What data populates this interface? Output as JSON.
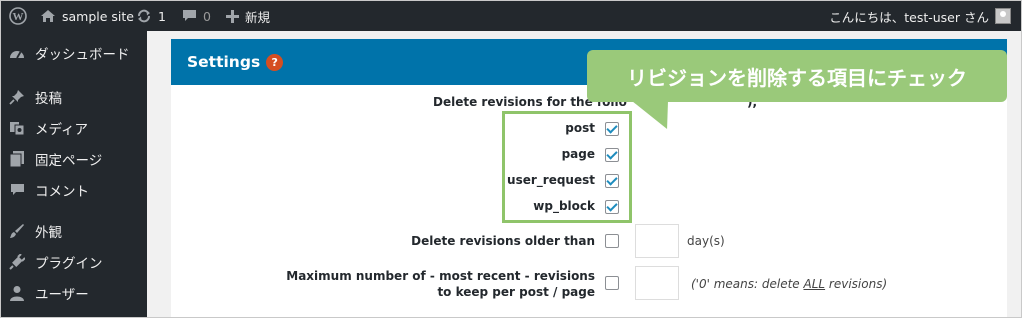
{
  "adminbar": {
    "site_name": "sample site",
    "updates_count": "1",
    "comments_count": "0",
    "new_label": "新規",
    "greeting": "こんにちは、test-user さん"
  },
  "sidebar": {
    "items": [
      {
        "label": "ダッシュボード",
        "icon": "dashboard-icon"
      },
      {
        "label": "投稿",
        "icon": "pin-icon"
      },
      {
        "label": "メディア",
        "icon": "media-icon"
      },
      {
        "label": "固定ページ",
        "icon": "pages-icon"
      },
      {
        "label": "コメント",
        "icon": "comment-icon"
      },
      {
        "label": "外観",
        "icon": "brush-icon"
      },
      {
        "label": "プラグイン",
        "icon": "plugin-icon"
      },
      {
        "label": "ユーザー",
        "icon": "user-icon"
      }
    ]
  },
  "settings": {
    "title": "Settings",
    "help": "?",
    "delete_for_label_visible": "Delete revisions for the follo",
    "delete_for_label_tail": "),",
    "post_types": [
      {
        "label": "post",
        "checked": true
      },
      {
        "label": "page",
        "checked": true
      },
      {
        "label": "user_request",
        "checked": true
      },
      {
        "label": "wp_block",
        "checked": true
      }
    ],
    "older_than_label": "Delete revisions older than",
    "older_than_unit": "day(s)",
    "max_label_line1": "Maximum number of - most recent - revisions",
    "max_label_line2": "to keep per post / page",
    "note_before": "('0' means: delete ",
    "note_all": "ALL",
    "note_after": " revisions)"
  },
  "annotation": {
    "callout_text": "リビジョンを削除する項目にチェック",
    "color": "#9ac97a"
  },
  "colors": {
    "adminbar": "#23282d",
    "header": "#0073aa",
    "help": "#d54e21",
    "check": "#1e8cbe"
  }
}
